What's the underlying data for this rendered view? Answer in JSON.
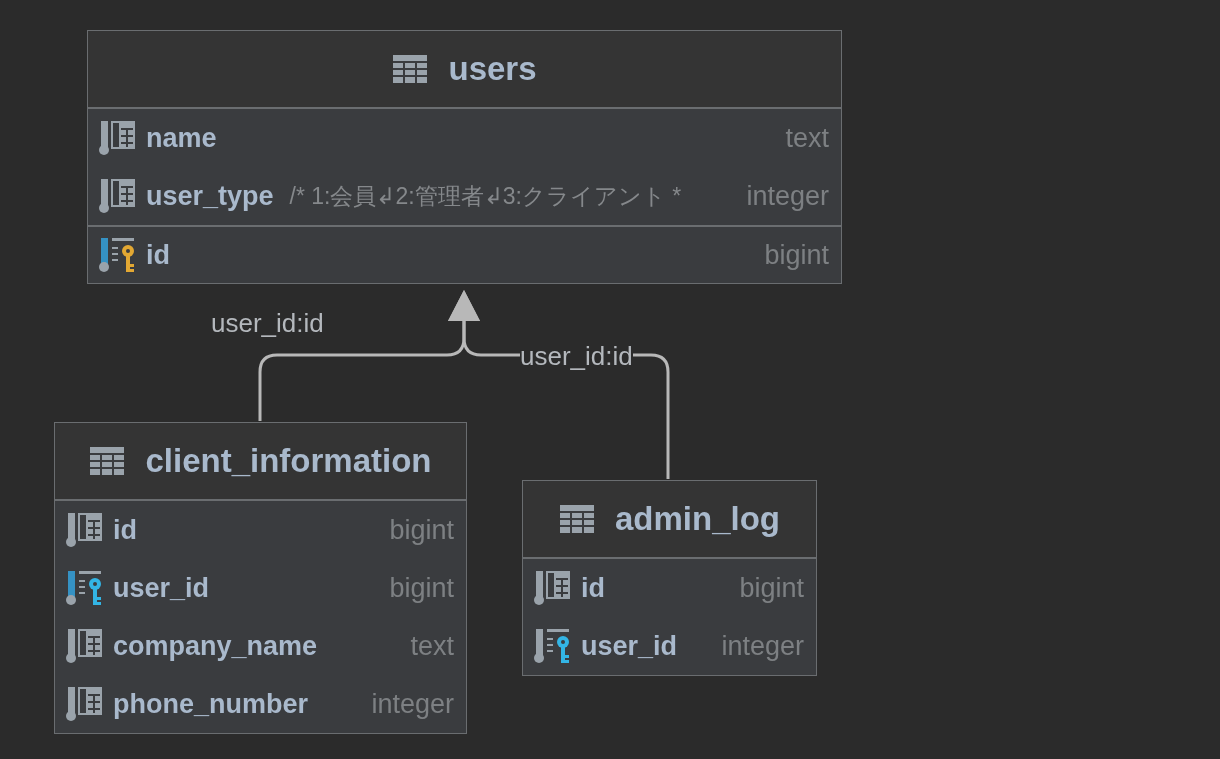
{
  "tables": [
    {
      "name": "users",
      "columns": [
        {
          "kind": "column",
          "name": "name",
          "type": "text",
          "not_null": false
        },
        {
          "kind": "column",
          "name": "user_type",
          "comment": "/* 1:会員↲2:管理者↲3:クライアント *",
          "type": "integer",
          "not_null": false
        },
        {
          "kind": "primary_key",
          "name": "id",
          "type": "bigint",
          "not_null": true
        }
      ]
    },
    {
      "name": "client_information",
      "columns": [
        {
          "kind": "column",
          "name": "id",
          "type": "bigint",
          "not_null": false
        },
        {
          "kind": "foreign_key",
          "name": "user_id",
          "type": "bigint",
          "not_null": true
        },
        {
          "kind": "column",
          "name": "company_name",
          "type": "text",
          "not_null": false
        },
        {
          "kind": "column",
          "name": "phone_number",
          "type": "integer",
          "not_null": false
        }
      ]
    },
    {
      "name": "admin_log",
      "columns": [
        {
          "kind": "column",
          "name": "id",
          "type": "bigint",
          "not_null": false
        },
        {
          "kind": "foreign_key",
          "name": "user_id",
          "type": "integer",
          "not_null": false
        }
      ]
    }
  ],
  "relations": [
    {
      "label": "user_id:id"
    },
    {
      "label": "user_id:id"
    }
  ]
}
